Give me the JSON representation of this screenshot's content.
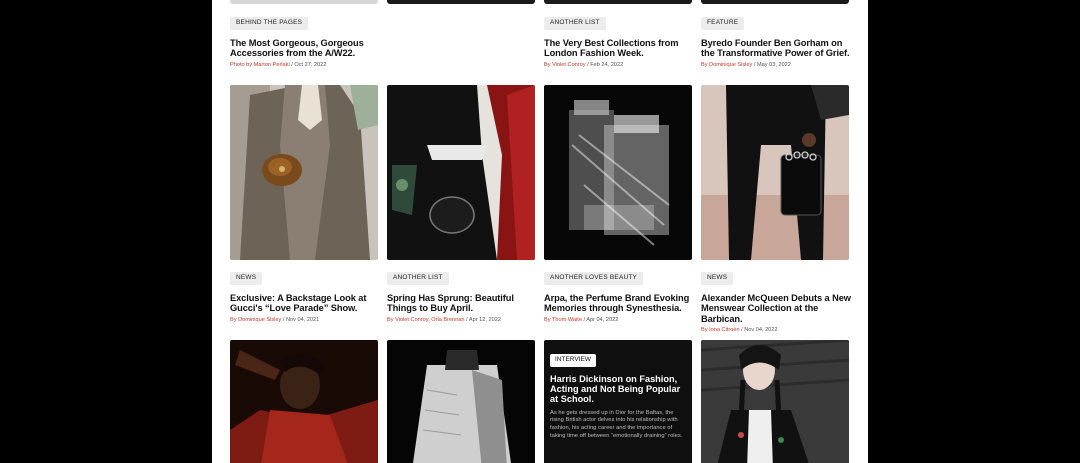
{
  "row1": [
    {
      "tag": "BEHIND THE PAGES",
      "title": "The Most Gorgeous, Gorgeous Accessories from the A/W22.",
      "author": "Photo by Marton Perlaki",
      "date": "/ Oct 27, 2022"
    },
    {
      "tag": "",
      "title": "",
      "author": "",
      "date": ""
    },
    {
      "tag": "ANOTHER LIST",
      "title": "The Very Best Collections from London Fashion Week.",
      "author": "By Violet Conroy",
      "date": "/ Feb 24, 2022"
    },
    {
      "tag": "FEATURE",
      "title": "Byredo Founder Ben Gorham on the Transformative Power of Grief.",
      "author": "By Dominique Sisley",
      "date": "/ May 03, 2022"
    }
  ],
  "row2": [
    {
      "tag": "NEWS",
      "title": "Exclusive: A Backstage Look at Gucci's “Love Parade” Show.",
      "author": "By Dominique Sisley",
      "date": "/ Nov 04, 2021",
      "image": "woman-camel-suit-gold-bag"
    },
    {
      "tag": "ANOTHER LIST",
      "title": "Spring Has Sprung: Beautiful Things to Buy April.",
      "author": "By Violet Conroy, Orla Brennan",
      "date": "/ Apr 12, 2022",
      "image": "black-dress-handbag"
    },
    {
      "tag": "ANOTHER LOVES BEAUTY",
      "title": "Arpa, the Perfume Brand Evoking Memories through Synesthesia.",
      "author": "By Thom Waite",
      "date": "/ Apr 04, 2022",
      "image": "perfume-glass-xray"
    },
    {
      "tag": "NEWS",
      "title": "Alexander McQueen Debuts a New Menswear Collection at the Barbican.",
      "author": "By Iona Citroën",
      "date": "/ Nov 04, 2022",
      "image": "suit-knuckle-bag"
    }
  ],
  "row3": [
    {
      "image": "man-red-shirt"
    },
    {
      "image": "white-top-back"
    },
    {
      "tag": "INTERVIEW",
      "title": "Harris Dickinson on Fashion, Acting and Not Being Popular at School.",
      "description": "As he gets dressed up in Dior for the Baftas, the rising British actor delves into his relationship with fashion, his acting career and the importance of taking time off between “emotionally draining” roles."
    },
    {
      "image": "woman-braids-embroidered-blouse"
    }
  ]
}
